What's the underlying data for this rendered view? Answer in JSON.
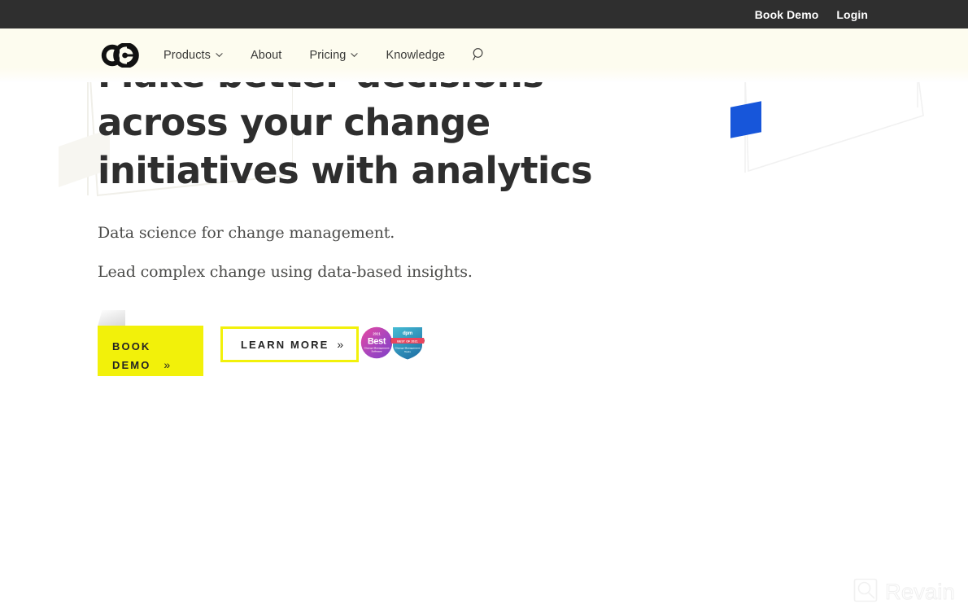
{
  "topbar": {
    "links": [
      {
        "label": "Book Demo",
        "name": "topbar-book-demo"
      },
      {
        "label": "Login",
        "name": "topbar-login"
      }
    ],
    "background_color": "#2f2f2f",
    "text_color": "#ffffff"
  },
  "header": {
    "logo_alt": "Change Compass logo",
    "background_color": "#fdfcef",
    "nav": [
      {
        "label": "Products",
        "has_caret": true
      },
      {
        "label": "About",
        "has_caret": false
      },
      {
        "label": "Pricing",
        "has_caret": true
      },
      {
        "label": "Knowledge",
        "has_caret": false
      }
    ],
    "search_icon": "search-icon"
  },
  "hero": {
    "title": "Make better decisions across your change initiatives with analytics",
    "subtitle_1": "Data science for change management.",
    "subtitle_2": "Lead complex change using data-based insights.",
    "title_color": "#2e2e2e",
    "accent_color": "#f2f10a",
    "decor_square_color": "#1756da"
  },
  "cta": {
    "primary": {
      "label_line_1": "BOOK",
      "label_line_2": "DEMO",
      "arrow": "»",
      "background": "#f2f10a",
      "text_color": "#242424"
    },
    "secondary": {
      "label": "LEARN MORE",
      "arrow": "»",
      "border_color": "#f2f10a",
      "background": "#ffffff",
      "text_color": "#242424"
    }
  },
  "badges": [
    {
      "name": "best-change-management-software-badge",
      "top_text": "2021",
      "main_text": "Best",
      "sub_text": "Change Management Software",
      "color_start": "#e0439c",
      "color_end": "#8a3fc0"
    },
    {
      "name": "dpm-best-of-2021-badge",
      "top_text": "dpm",
      "ribbon_text": "BEST OF 2021",
      "sub_text": "Change Management Tools",
      "color_start": "#3fb4cf",
      "color_end": "#2a7fae",
      "ribbon_color": "#e8455f"
    }
  ],
  "watermark": {
    "label": "Revain",
    "icon": "magnifier-square-icon",
    "color": "#f2f2f2"
  }
}
